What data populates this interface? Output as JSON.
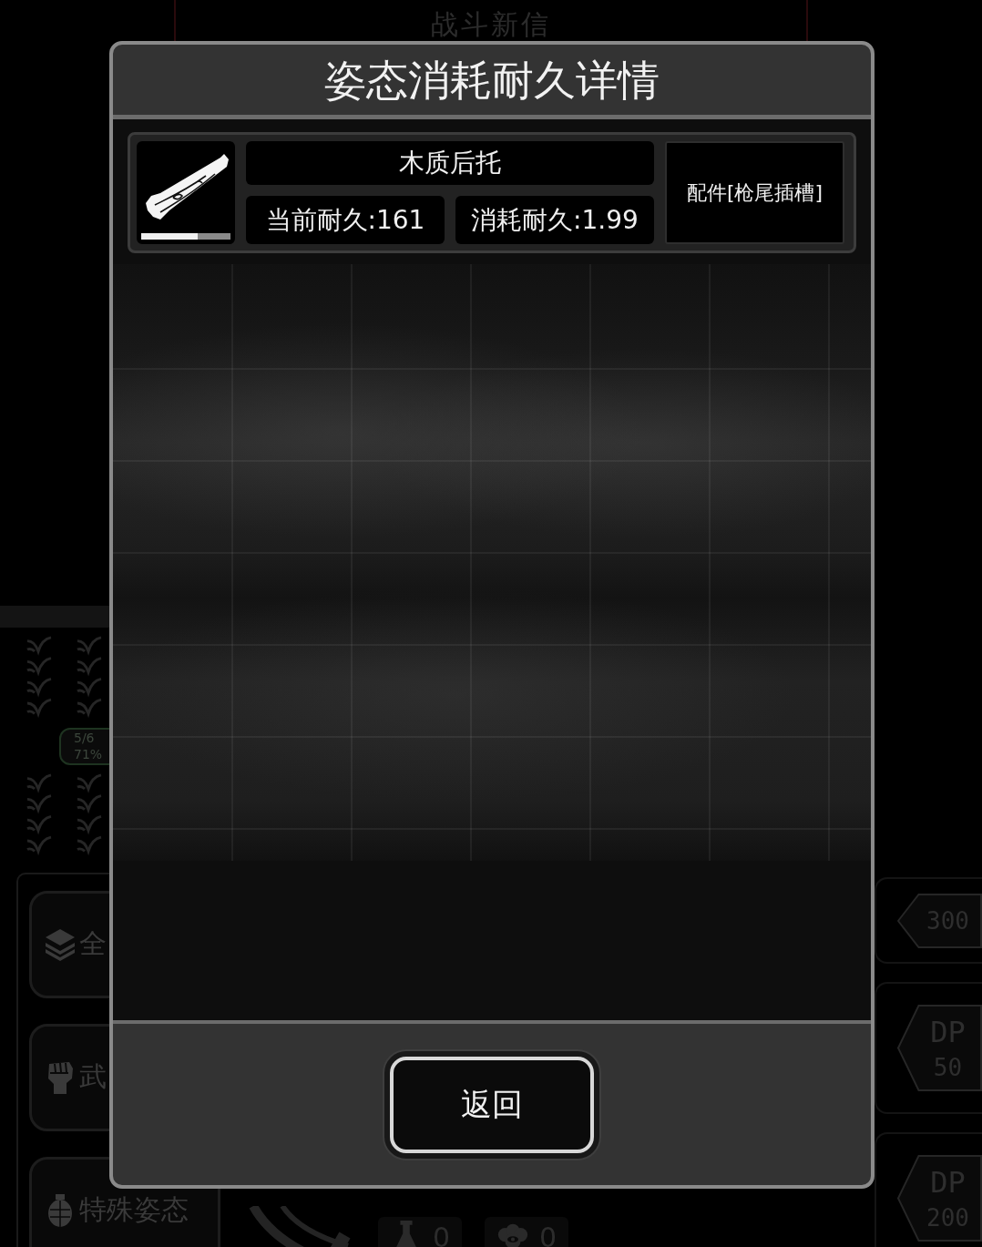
{
  "background": {
    "banner": "战斗新信",
    "ratio_badge": {
      "ratio": "5/6",
      "percent": "71%"
    },
    "side_buttons": [
      {
        "kind": "layers",
        "label": "全"
      },
      {
        "kind": "fist",
        "label": "武"
      },
      {
        "kind": "grenade",
        "label": "特殊姿态"
      }
    ],
    "cost_tags": [
      {
        "value": "300"
      },
      {
        "label": "DP",
        "value": "50"
      },
      {
        "label": "DP",
        "value": "200"
      }
    ],
    "resources": [
      {
        "kind": "flask",
        "count": "0"
      },
      {
        "kind": "brain",
        "count": "0"
      }
    ]
  },
  "dialog": {
    "title": "姿态消耗耐久详情",
    "items": [
      {
        "name": "木质后托",
        "current_durability": "当前耐久:161",
        "consumed_durability": "消耗耐久:1.99",
        "slot": "配件[枪尾插槽]",
        "level": 0.63
      }
    ],
    "buttons": [
      "返回"
    ]
  }
}
